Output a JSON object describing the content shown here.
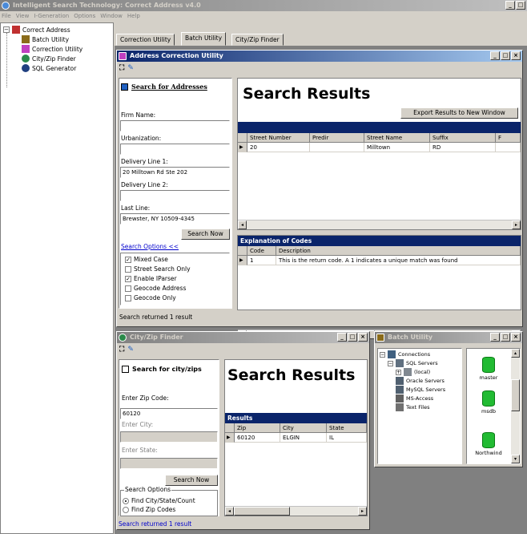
{
  "app": {
    "title": "Intelligent Search Technology:  Correct Address v4.0",
    "menu": [
      "File",
      "View",
      "I-Generation",
      "Options",
      "Window",
      "Help"
    ]
  },
  "tree": {
    "root": "Correct Address",
    "items": [
      "Batch Utility",
      "Correction Utility",
      "City/Zip Finder",
      "SQL Generator"
    ]
  },
  "tabs": [
    "Correction Utility",
    "Batch Utility",
    "City/Zip Finder"
  ],
  "address_window": {
    "title": "Address Correction Utility",
    "search_heading": "Search for Addresses",
    "fields": [
      {
        "label": "Firm Name:",
        "value": ""
      },
      {
        "label": "Urbanization:",
        "value": ""
      },
      {
        "label": "Delivery Line 1:",
        "value": "20 Milltown Rd Ste 202"
      },
      {
        "label": "Delivery Line 2:",
        "value": ""
      },
      {
        "label": "Last Line:",
        "value": "Brewster, NY 10509-4345"
      }
    ],
    "search_button": "Search Now",
    "options_link": "Search Options <<",
    "options": [
      {
        "label": "Mixed Case",
        "checked": true
      },
      {
        "label": "Street Search Only",
        "checked": false
      },
      {
        "label": "Enable IParser",
        "checked": true
      },
      {
        "label": "Geocode Address",
        "checked": false
      },
      {
        "label": "Geocode Only",
        "checked": false
      }
    ],
    "status": "Search returned   1 result",
    "results_title": "Search Results",
    "export_button": "Export Results to New Window",
    "result_columns": [
      "Street Number",
      "Predir",
      "Street Name",
      "Suffix",
      "F"
    ],
    "result_rows": [
      [
        "20",
        "",
        "Milltown",
        "RD",
        ""
      ]
    ],
    "codes_header": "Explanation of Codes",
    "codes_columns": [
      "Code",
      "Description"
    ],
    "codes_rows": [
      [
        "1",
        "This is the return code. A 1 indicates a unique match was found"
      ]
    ]
  },
  "cityzip_window": {
    "title": "City/Zip Finder",
    "search_heading": "Search for city/zips",
    "zip_label": "Enter Zip Code:",
    "zip_value": "60120",
    "city_label": "Enter City:",
    "state_label": "Enter State:",
    "search_button": "Search Now",
    "options_group": "Search Options",
    "radio_options": [
      {
        "label": "Find City/State/Count",
        "selected": true
      },
      {
        "label": "Find Zip Codes",
        "selected": false
      }
    ],
    "status": "Search returned   1 result",
    "results_title": "Search Results",
    "results_header": "Results",
    "columns": [
      "Zip",
      "City",
      "State"
    ],
    "rows": [
      [
        "60120",
        "ELGIN",
        "IL"
      ]
    ]
  },
  "batch_window": {
    "title": "Batch Utility",
    "tree_root": "Connections",
    "tree": [
      {
        "label": "SQL Servers",
        "level": 1
      },
      {
        "label": "(local)",
        "level": 2
      },
      {
        "label": "Oracle Servers",
        "level": 1
      },
      {
        "label": "MySQL Servers",
        "level": 1
      },
      {
        "label": "MS-Access",
        "level": 1
      },
      {
        "label": "Text Files",
        "level": 1
      }
    ],
    "databases": [
      "master",
      "msdb",
      "Northwind"
    ]
  }
}
